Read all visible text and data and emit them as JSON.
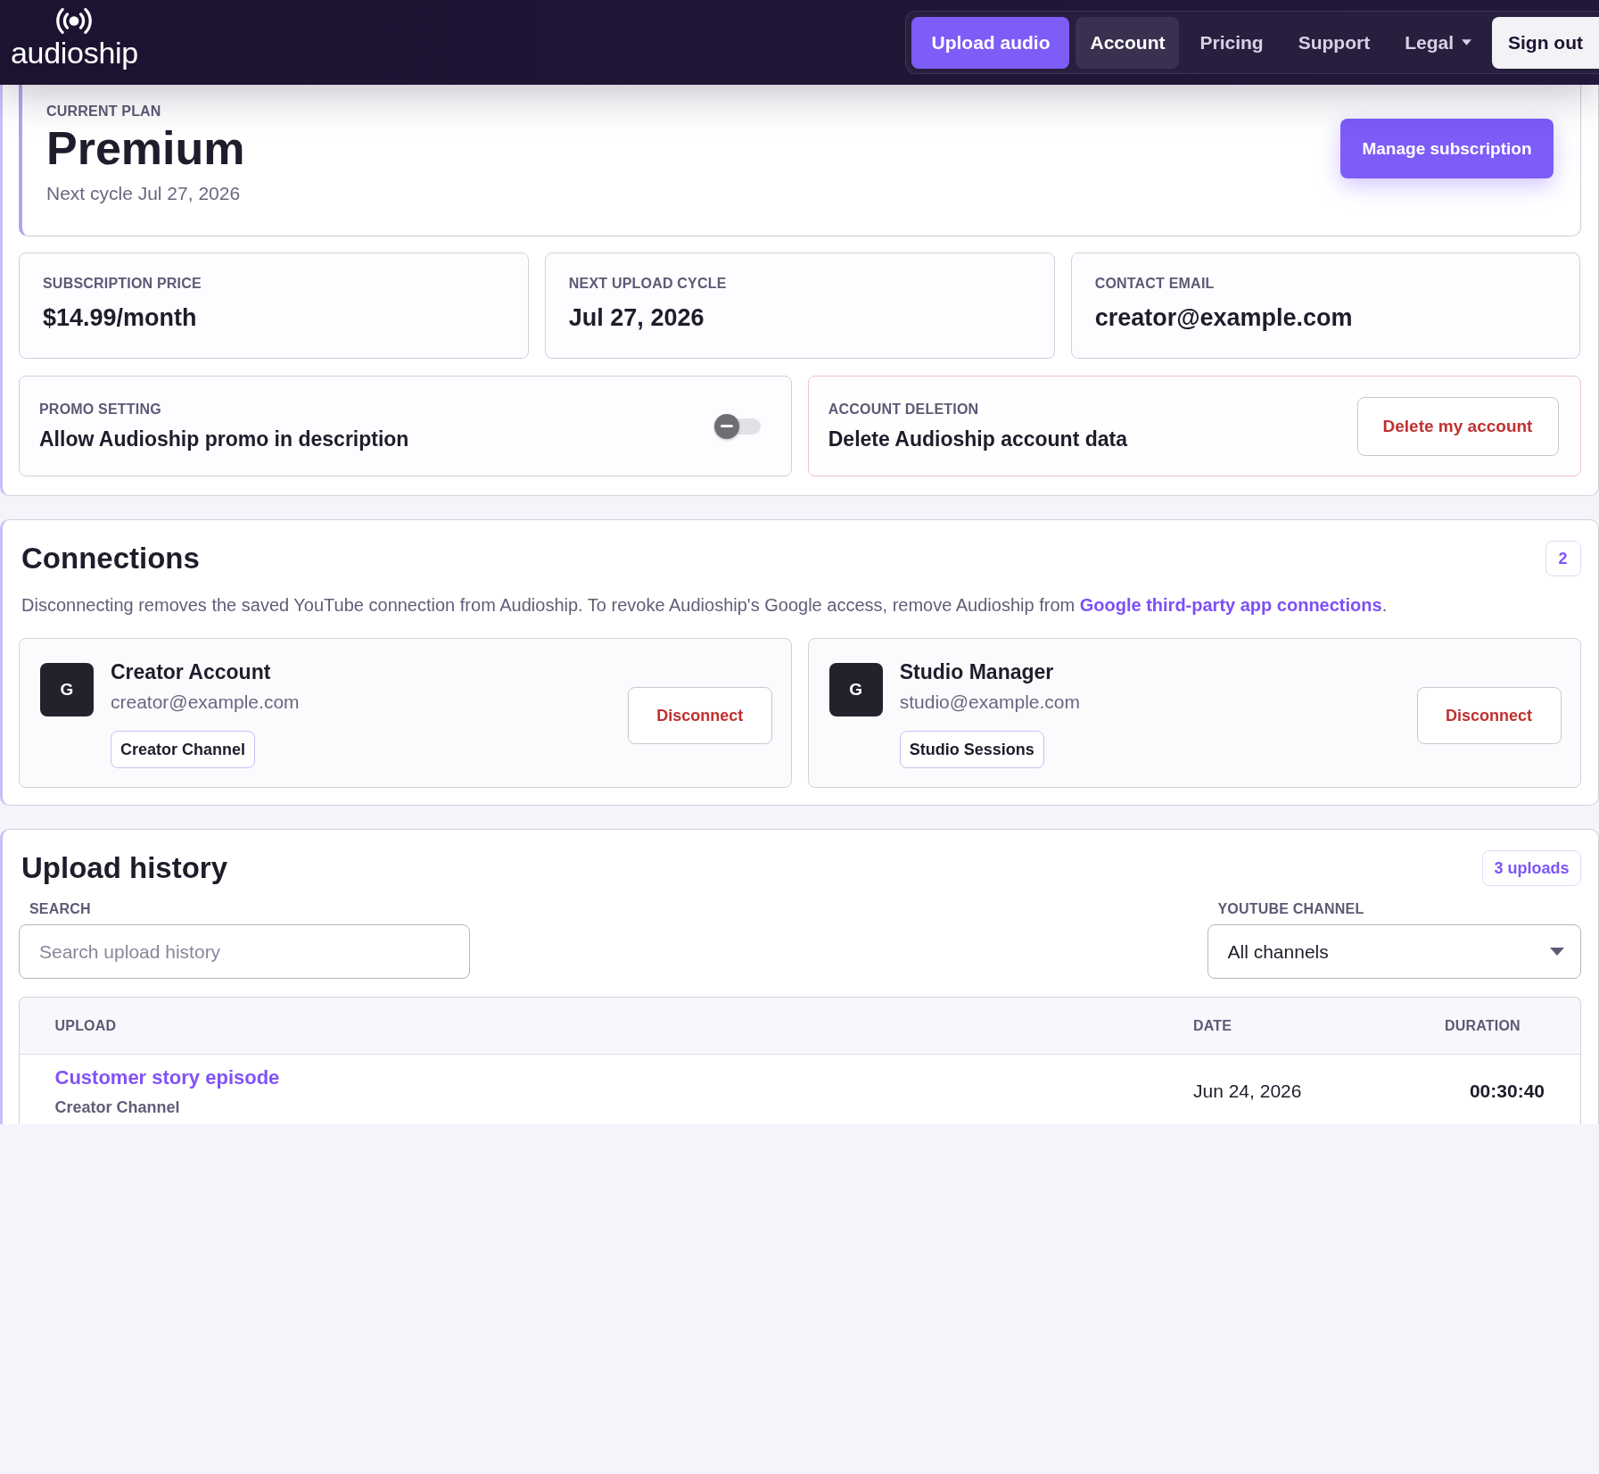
{
  "header": {
    "logo": "audioship",
    "nav": [
      {
        "label": "Upload audio",
        "kind": "primary",
        "selected": false
      },
      {
        "label": "Account",
        "kind": "link",
        "selected": true
      },
      {
        "label": "Pricing",
        "kind": "link",
        "selected": false
      },
      {
        "label": "Support",
        "kind": "link",
        "selected": false
      },
      {
        "label": "Legal",
        "kind": "menu",
        "selected": false
      },
      {
        "label": "Sign out",
        "kind": "secondary",
        "selected": false
      }
    ]
  },
  "plan": {
    "label": "CURRENT PLAN",
    "name": "Premium",
    "next_cycle": "Next cycle Jul 27, 2026",
    "button": "Manage subscription"
  },
  "stats": [
    {
      "label": "SUBSCRIPTION PRICE",
      "value": "$14.99/month"
    },
    {
      "label": "NEXT UPLOAD CYCLE",
      "value": "Jul 27, 2026"
    },
    {
      "label": "CONTACT EMAIL",
      "value": "creator@example.com"
    }
  ],
  "settings": [
    {
      "kind": "toggle",
      "label": "PROMO SETTING",
      "text": "Allow Audioship promo in description",
      "on": false
    },
    {
      "kind": "danger",
      "label": "ACCOUNT DELETION",
      "text": "Delete Audioship account data",
      "button": "Delete my account"
    }
  ],
  "connections": {
    "title": "Connections",
    "count": "2",
    "description": "Disconnecting removes the saved YouTube connection from Audioship. To revoke Audioship's Google access, remove Audioship from ",
    "link": "Google third-party app connections",
    "description_end": ".",
    "accounts": [
      {
        "avatar": "G",
        "name": "Creator Account",
        "email": "creator@example.com",
        "channel": "Creator Channel",
        "button": "Disconnect"
      },
      {
        "avatar": "G",
        "name": "Studio Manager",
        "email": "studio@example.com",
        "channel": "Studio Sessions",
        "button": "Disconnect"
      }
    ]
  },
  "upload_history": {
    "title": "Upload history",
    "count": "3 uploads",
    "search": {
      "label": "SEARCH",
      "placeholder": "Search upload history"
    },
    "channel_filter": {
      "label": "YOUTUBE CHANNEL",
      "value": "All channels"
    },
    "table": {
      "columns": [
        "UPLOAD",
        "DATE",
        "DURATION"
      ],
      "rows": [
        {
          "title": "Customer story episode",
          "channel": "Creator Channel",
          "date": "Jun 24, 2026",
          "duration": "00:30:40"
        }
      ]
    }
  }
}
